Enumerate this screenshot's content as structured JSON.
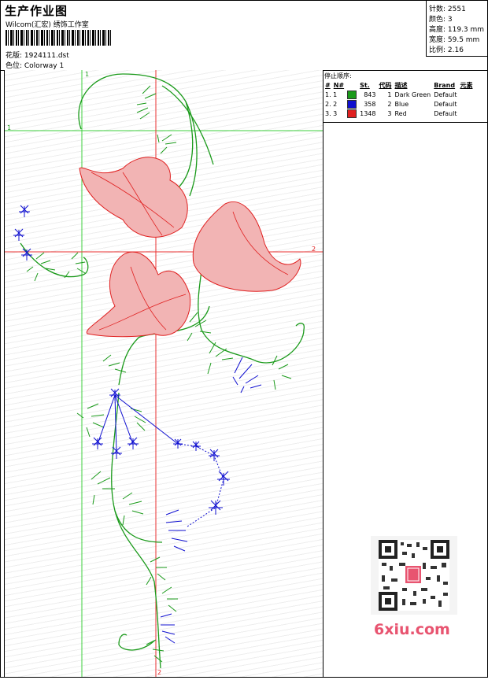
{
  "header": {
    "title": "生产作业图",
    "company": "Wilcom(汇宏) 绣饰工作室",
    "file_label": "花版: 1924111.dst",
    "colorway_label": "色位: Colorway 1"
  },
  "stats": {
    "stitches": "针数: 2551",
    "colors": "颜色: 3",
    "height": "高度: 119.3 mm",
    "width": "宽度: 59.5 mm",
    "ratio": "比例: 2.16"
  },
  "stop_sequence": {
    "title": "停止顺序:",
    "columns": [
      "#",
      "N#",
      "St.",
      "代码",
      "描述",
      "Brand",
      "元素"
    ],
    "rows": [
      {
        "idx": "1. 1",
        "color": "#1a9a1a",
        "st": "843",
        "code": "1",
        "desc": "Dark Green",
        "brand": "Default"
      },
      {
        "idx": "2. 2",
        "color": "#1010d0",
        "st": "358",
        "code": "2",
        "desc": "Blue",
        "brand": "Default"
      },
      {
        "idx": "3. 3",
        "color": "#e02020",
        "st": "1348",
        "code": "3",
        "desc": "Red",
        "brand": "Default"
      }
    ]
  },
  "axis_labels": {
    "v1": "1",
    "h1": "1",
    "h2": "2",
    "v2": "2"
  },
  "colors": {
    "green": "#1a9a1a",
    "blue": "#1010d0",
    "red": "#e02020",
    "guide_green": "#3ccf3c",
    "guide_red": "#e83030"
  },
  "watermark": "6xiu.com"
}
